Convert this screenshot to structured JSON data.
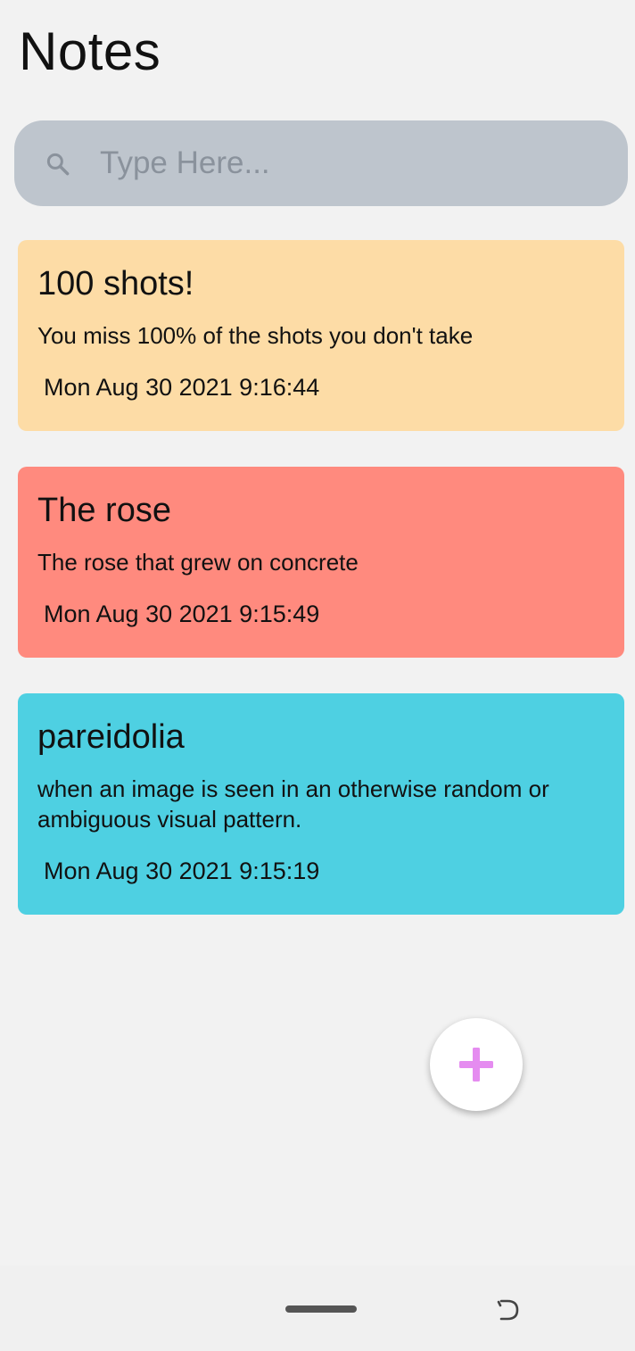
{
  "app": {
    "title": "Notes"
  },
  "search": {
    "placeholder": "Type Here...",
    "value": "",
    "icon": "search-icon"
  },
  "notes": [
    {
      "title": "100 shots!",
      "body": "You miss 100% of the shots you don't take",
      "date": "Mon Aug 30 2021 9:16:44",
      "color": "#fddca6"
    },
    {
      "title": "The rose",
      "body": "The rose that grew on concrete",
      "date": "Mon Aug 30 2021 9:15:49",
      "color": "#ff8a7e"
    },
    {
      "title": "pareidolia",
      "body": "when an image is seen in an otherwise random or ambiguous visual pattern.",
      "date": "Mon Aug 30 2021 9:15:19",
      "color": "#4ed0e2"
    }
  ],
  "fab": {
    "icon": "plus-icon",
    "color": "#e58cf0"
  },
  "system_nav": {
    "home_handle": "home-handle",
    "rotate_icon": "rotate-icon"
  }
}
